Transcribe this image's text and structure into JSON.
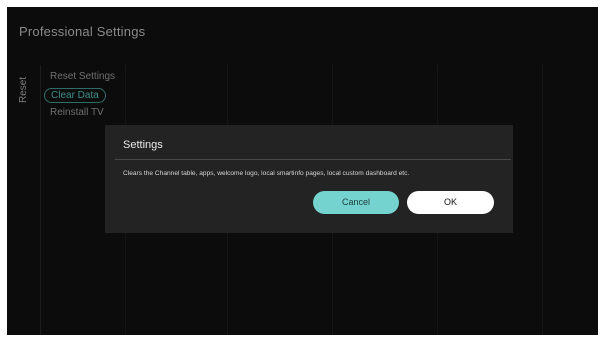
{
  "header": {
    "title": "Professional Settings"
  },
  "side_tab": {
    "label": "Reset"
  },
  "menu": {
    "items": [
      {
        "label": "Reset Settings",
        "selected": false
      },
      {
        "label": "Clear Data",
        "selected": true
      },
      {
        "label": "Reinstall TV",
        "selected": false
      }
    ]
  },
  "dialog": {
    "title": "Settings",
    "message": "Clears the Channel table, apps, welcome logo, local smartinfo pages, local custom dashboard etc.",
    "cancel_label": "Cancel",
    "ok_label": "OK"
  },
  "colors": {
    "background": "#0c0c0c",
    "dialog_background": "#232323",
    "accent": "#75d3cf",
    "selected_text": "#3e8f89"
  }
}
